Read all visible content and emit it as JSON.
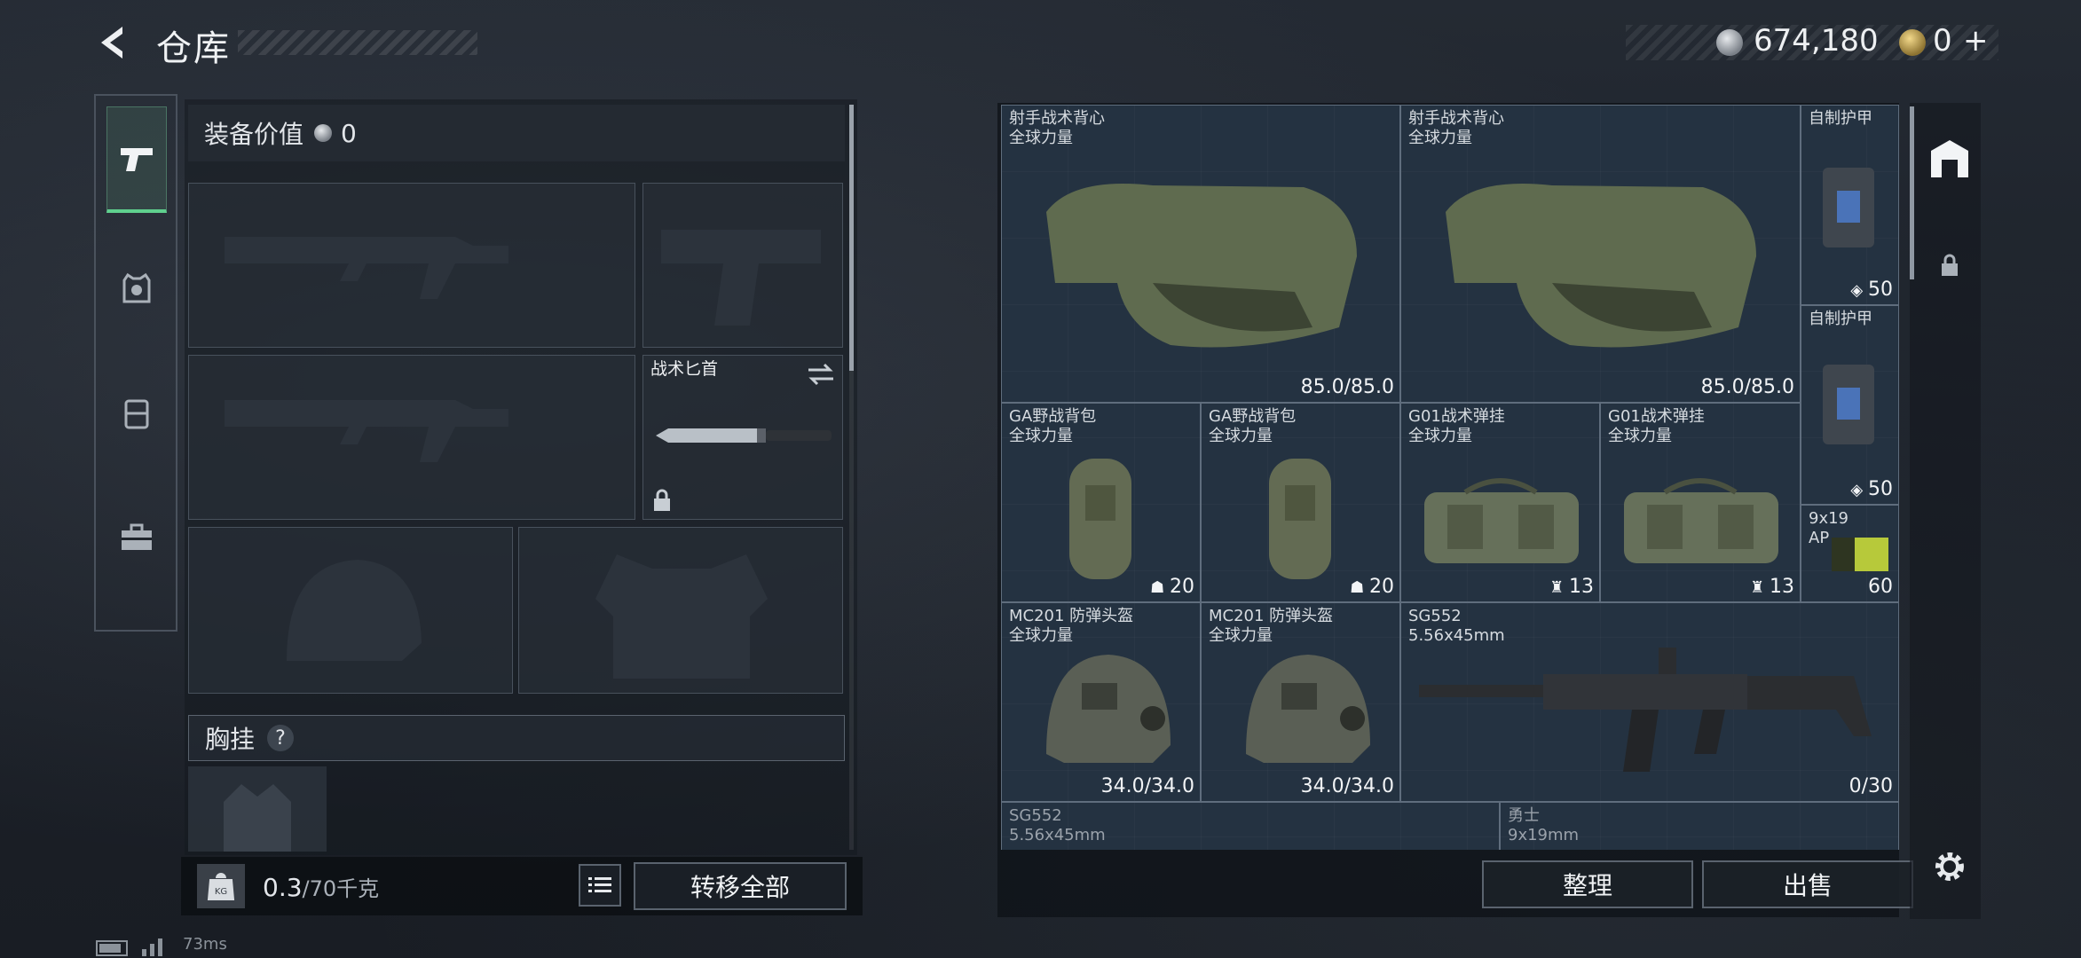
{
  "header": {
    "title": "仓库",
    "silver_amount": "674,180",
    "gold_amount": "0",
    "add_label": "+"
  },
  "left": {
    "equip_value_label": "装备价值",
    "equip_value": "0",
    "knife_label": "战术匕首",
    "chest_label": "胸挂",
    "help_label": "?",
    "weight_current": "0.3",
    "weight_max": "/70千克",
    "kg_label": "KG",
    "transfer_all": "转移全部"
  },
  "grid": {
    "items": [
      {
        "name1": "射手战术背心",
        "name2": "全球力量",
        "value": "85.0/85.0"
      },
      {
        "name1": "射手战术背心",
        "name2": "全球力量",
        "value": "85.0/85.0"
      },
      {
        "name1": "自制护甲",
        "name2": "",
        "value": "50"
      },
      {
        "name1": "自制护甲",
        "name2": "",
        "value": "50"
      },
      {
        "name1": "GA野战背包",
        "name2": "全球力量",
        "value": "20"
      },
      {
        "name1": "GA野战背包",
        "name2": "全球力量",
        "value": "20"
      },
      {
        "name1": "G01战术弹挂",
        "name2": "全球力量",
        "value": "13"
      },
      {
        "name1": "G01战术弹挂",
        "name2": "全球力量",
        "value": "13"
      },
      {
        "name1": "9x19",
        "name2": "AP",
        "value": "60"
      },
      {
        "name1": "MC201 防弹头盔",
        "name2": "全球力量",
        "value": "34.0/34.0"
      },
      {
        "name1": "MC201 防弹头盔",
        "name2": "全球力量",
        "value": "34.0/34.0"
      },
      {
        "name1": "SG552",
        "name2": "5.56x45mm",
        "value": "0/30"
      },
      {
        "name1": "SG552",
        "name2": "5.56x45mm",
        "value": ""
      },
      {
        "name1": "勇士",
        "name2": "9x19mm",
        "value": ""
      }
    ]
  },
  "actions": {
    "sort": "整理",
    "sell": "出售"
  },
  "status": {
    "ping": "73ms"
  },
  "colors": {
    "accent_green": "#5fd08e",
    "cell_border": "#5f6d7d"
  }
}
